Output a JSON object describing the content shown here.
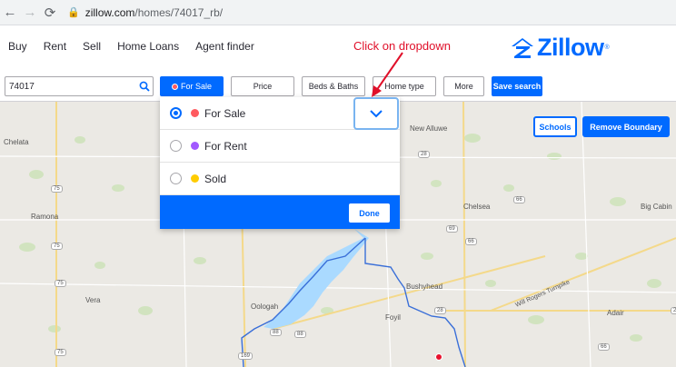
{
  "browser": {
    "url_domain": "zillow.com",
    "url_path": "/homes/74017_rb/"
  },
  "nav": {
    "links": [
      "Buy",
      "Rent",
      "Sell",
      "Home Loans",
      "Agent finder"
    ],
    "logo_text": "Zillow",
    "logo_mark": "®"
  },
  "annotation": {
    "text": "Click on dropdown",
    "color": "#e0102a"
  },
  "filters": {
    "search_value": "74017",
    "for_sale": "For Sale",
    "price": "Price",
    "beds_baths": "Beds & Baths",
    "home_type": "Home type",
    "more": "More",
    "save_search": "Save search"
  },
  "dropdown": {
    "options": [
      {
        "label": "For Sale",
        "color": "#ff5a5f",
        "checked": true
      },
      {
        "label": "For Rent",
        "color": "#a259ff",
        "checked": false
      },
      {
        "label": "Sold",
        "color": "#ffcc00",
        "checked": false
      }
    ],
    "done": "Done"
  },
  "map": {
    "schools": "Schools",
    "remove_boundary": "Remove Boundary",
    "places": [
      "Chelata",
      "Ramona",
      "Vera",
      "Oologah",
      "New Alluwe",
      "Chelsea",
      "Big Cabin",
      "Bushyhead",
      "Foyil",
      "Adair"
    ],
    "road_label": "Will Rogers Turnpike",
    "route_shields": [
      "75",
      "75",
      "75",
      "75",
      "169",
      "169",
      "88",
      "88",
      "28",
      "28",
      "66",
      "66",
      "66",
      "28",
      "69"
    ]
  },
  "colors": {
    "brand": "#006aff",
    "water": "#aadaff",
    "boundary": "#3a6fd8"
  }
}
